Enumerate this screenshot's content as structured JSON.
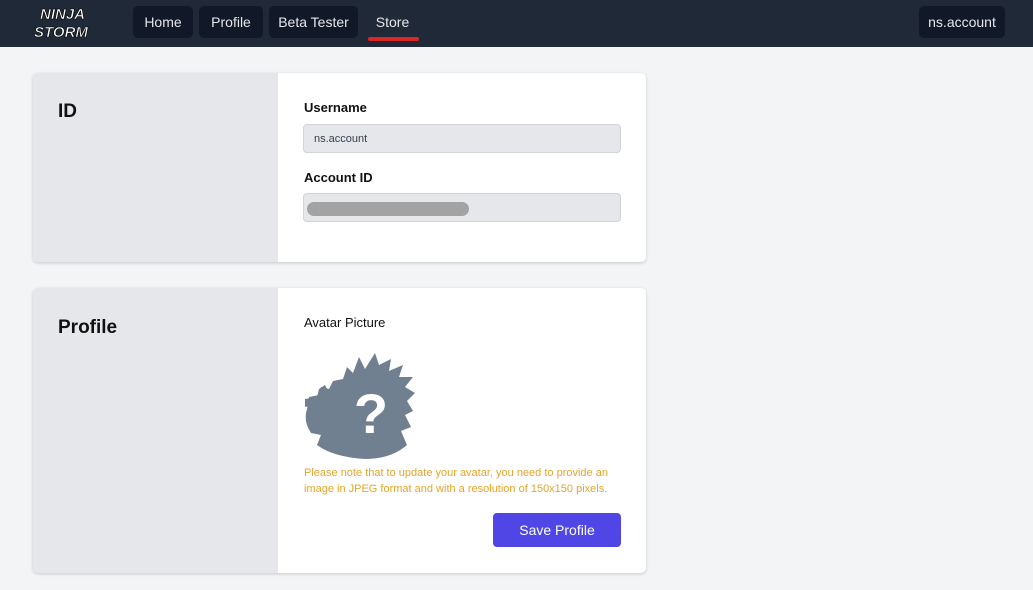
{
  "header": {
    "logo_alt": "NINJA STORM",
    "nav": [
      {
        "label": "Home"
      },
      {
        "label": "Profile"
      },
      {
        "label": "Beta Tester"
      },
      {
        "label": "Store"
      }
    ],
    "active_tab": "Store",
    "account_label": "ns.account"
  },
  "id_card": {
    "title": "ID",
    "username_label": "Username",
    "username_value": "ns.account",
    "account_id_label": "Account ID",
    "account_id_value": ""
  },
  "profile_card": {
    "title": "Profile",
    "avatar_label": "Avatar Picture",
    "note": "Please note that to update your avatar, you need to provide an image in JPEG format and with a resolution of 150x150 pixels.",
    "save_label": "Save Profile"
  },
  "colors": {
    "topbar": "#1f2937",
    "accent": "#4f46e5",
    "active_underline": "#dc2626",
    "warning_text": "#e3a52b",
    "avatar_fill": "#708090"
  }
}
